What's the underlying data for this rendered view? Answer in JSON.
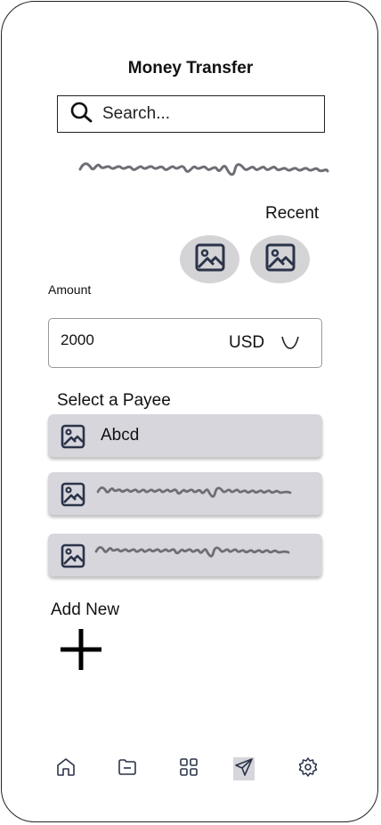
{
  "header": {
    "title": "Money Transfer"
  },
  "search": {
    "placeholder": "Search..."
  },
  "recent": {
    "label": "Recent"
  },
  "amount": {
    "label": "Amount",
    "value": "2000",
    "currency": "USD"
  },
  "payees": {
    "label": "Select a Payee",
    "items": [
      {
        "name": "Abcd"
      }
    ]
  },
  "add_new": {
    "label": "Add New"
  },
  "bottom_nav": {
    "items": [
      {
        "icon": "home-icon"
      },
      {
        "icon": "folder-icon"
      },
      {
        "icon": "grid-icon"
      },
      {
        "icon": "send-icon",
        "active": true
      },
      {
        "icon": "settings-icon"
      }
    ]
  },
  "colors": {
    "card": "#d6d6dc",
    "scribble": "#6e6e75",
    "accent_dark": "#2b3449"
  }
}
